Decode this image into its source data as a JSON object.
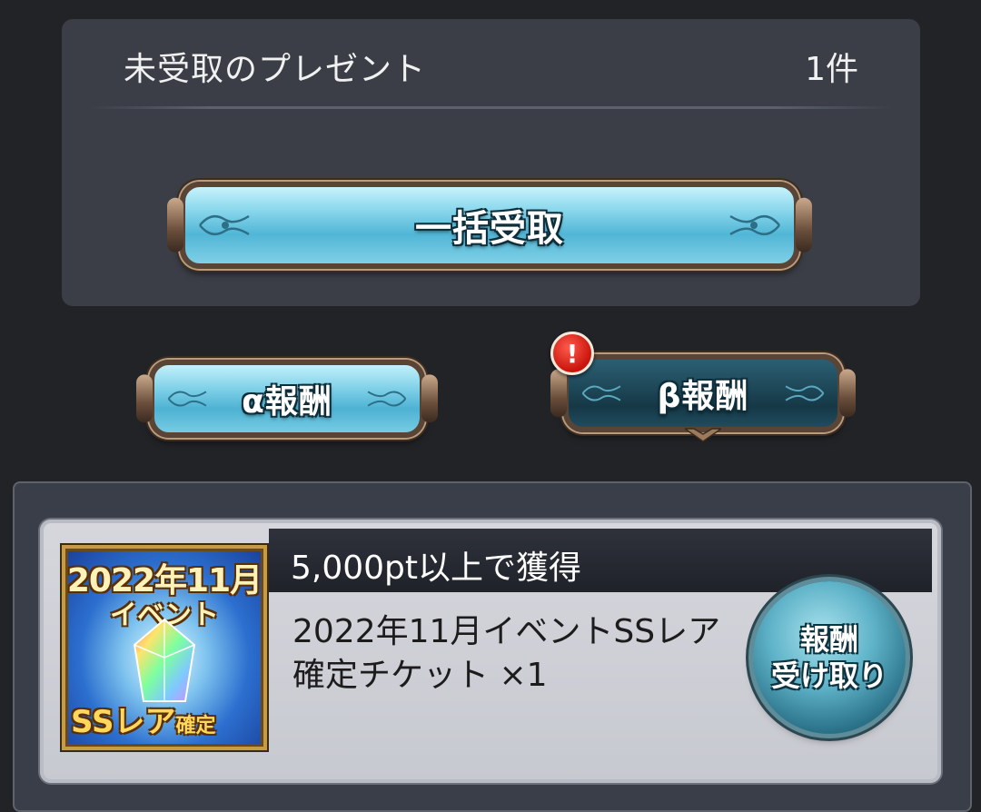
{
  "present_box": {
    "title": "未受取のプレゼント",
    "count": "1件",
    "bulk_receive_label": "一括受取"
  },
  "reward_tabs": {
    "alpha_label": "α報酬",
    "beta_label": "β報酬",
    "beta_alert": "!"
  },
  "reward_item": {
    "condition": "5,000pt以上で獲得",
    "description": "2022年11月イベントSSレア確定チケット ×1",
    "thumbnail": {
      "line1": "2022年11月",
      "line2": "イベント",
      "line3_main": "SSレア",
      "line3_small": "確定"
    },
    "claim_line1": "報酬",
    "claim_line2": "受け取り"
  },
  "colors": {
    "background": "#222326",
    "panel": "#3b3e47",
    "button_cyan": "#51b6d6",
    "button_dark_teal": "#1d4656",
    "alert_red": "#c9140b",
    "frame_gold": "#c79a45"
  },
  "icons": [
    "ornament-icon",
    "alert-icon",
    "crystal-icon"
  ]
}
